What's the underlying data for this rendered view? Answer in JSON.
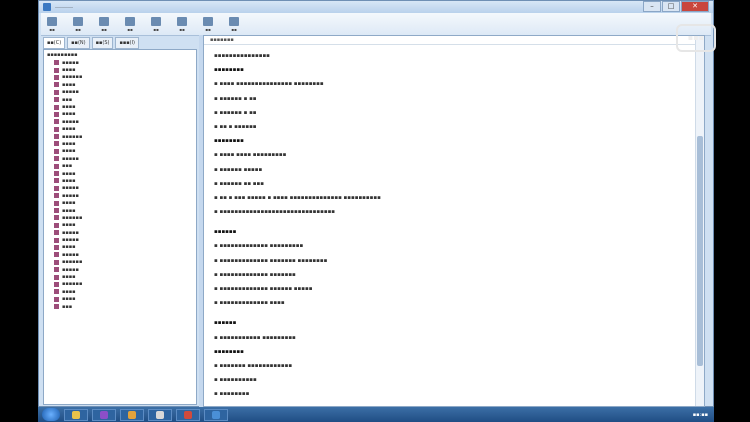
{
  "window": {
    "title": "………",
    "minimize": "–",
    "maximize": "□",
    "close": "✕"
  },
  "toolbar": [
    {
      "name": "hide-tool",
      "icon": "hide-icon",
      "label": "▪▪"
    },
    {
      "name": "locate-tool",
      "icon": "locate-icon",
      "label": "▪▪"
    },
    {
      "name": "back-tool",
      "icon": "back-icon",
      "label": "▪▪"
    },
    {
      "name": "forward-tool",
      "icon": "forward-icon",
      "label": "▪▪"
    },
    {
      "name": "home-tool",
      "icon": "home-icon",
      "label": "▪▪"
    },
    {
      "name": "print-tool",
      "icon": "print-icon",
      "label": "▪▪"
    },
    {
      "name": "options-tool",
      "icon": "options-icon",
      "label": "▪▪"
    },
    {
      "name": "help-tool",
      "icon": "help-icon",
      "label": "▪▪"
    }
  ],
  "tabs": [
    "▪▪(C)",
    "▪▪(N)",
    "▪▪(S)",
    "▪▪▪(I)"
  ],
  "toc": {
    "root": "▪▪▪▪▪▪▪▪▪",
    "items": [
      "▪▪▪▪▪",
      "▪▪▪▪",
      "▪▪▪▪▪▪",
      "▪▪▪▪",
      "▪▪▪▪▪",
      "▪▪▪",
      "▪▪▪▪",
      "▪▪▪▪",
      "▪▪▪▪▪",
      "▪▪▪▪",
      "▪▪▪▪▪▪",
      "▪▪▪▪",
      "▪▪▪▪",
      "▪▪▪▪▪",
      "▪▪▪",
      "▪▪▪▪",
      "▪▪▪▪",
      "▪▪▪▪▪",
      "▪▪▪▪▪",
      "▪▪▪▪",
      "▪▪▪▪",
      "▪▪▪▪▪▪",
      "▪▪▪▪",
      "▪▪▪▪▪",
      "▪▪▪▪▪",
      "▪▪▪▪",
      "▪▪▪▪▪",
      "▪▪▪▪▪▪",
      "▪▪▪▪▪",
      "▪▪▪▪",
      "▪▪▪▪▪▪",
      "▪▪▪▪",
      "▪▪▪▪",
      "▪▪▪"
    ]
  },
  "content": {
    "header": "▪▪▪▪▪▪▪",
    "lines": [
      {
        "t": "▪▪▪▪▪▪▪▪▪▪▪▪▪▪▪",
        "h": false
      },
      {
        "t": "▪▪▪▪▪▪▪▪",
        "h": true
      },
      {
        "t": "▪ ▪▪▪▪ ▪▪▪▪▪▪▪▪▪▪▪▪▪▪▪ ▪▪▪▪▪▪▪▪",
        "h": false
      },
      {
        "t": "▪ ▪▪▪▪▪▪ ▪ ▪▪",
        "h": false
      },
      {
        "t": "▪ ▪▪▪▪▪▪ ▪ ▪▪",
        "h": false
      },
      {
        "t": "▪ ▪▪ ▪ ▪▪▪▪▪▪",
        "h": false
      },
      {
        "t": "▪▪▪▪▪▪▪▪",
        "h": true
      },
      {
        "t": "▪ ▪▪▪▪ ▪▪▪▪ ▪▪▪▪▪▪▪▪▪",
        "h": false
      },
      {
        "t": "▪ ▪▪▪▪▪▪ ▪▪▪▪▪",
        "h": false
      },
      {
        "t": "▪ ▪▪▪▪▪▪ ▪▪ ▪▪▪",
        "h": false
      },
      {
        "t": "▪ ▪▪ ▪ ▪▪▪ ▪▪▪▪▪ ▪ ▪▪▪▪ ▪▪▪▪▪▪▪▪▪▪▪▪▪▪ ▪▪▪▪▪▪▪▪▪▪",
        "h": false
      },
      {
        "t": "▪ ▪▪▪▪▪▪▪▪▪▪▪▪▪▪▪▪▪▪▪▪▪▪▪▪▪▪▪▪▪▪▪",
        "h": false
      },
      {
        "t": "",
        "h": false
      },
      {
        "t": "▪▪▪▪▪▪",
        "h": true
      },
      {
        "t": "▪ ▪▪▪▪▪▪▪▪▪▪▪▪▪ ▪▪▪▪▪▪▪▪▪",
        "h": false
      },
      {
        "t": "▪ ▪▪▪▪▪▪▪▪▪▪▪▪▪ ▪▪▪▪▪▪▪ ▪▪▪▪▪▪▪▪",
        "h": false
      },
      {
        "t": "▪ ▪▪▪▪▪▪▪▪▪▪▪▪▪ ▪▪▪▪▪▪▪",
        "h": false
      },
      {
        "t": "▪ ▪▪▪▪▪▪▪▪▪▪▪▪▪ ▪▪▪▪▪▪ ▪▪▪▪▪",
        "h": false
      },
      {
        "t": "▪ ▪▪▪▪▪▪▪▪▪▪▪▪▪ ▪▪▪▪",
        "h": false
      },
      {
        "t": "",
        "h": false
      },
      {
        "t": "▪▪▪▪▪▪",
        "h": true
      },
      {
        "t": "▪ ▪▪▪▪▪▪▪▪▪▪▪ ▪▪▪▪▪▪▪▪▪",
        "h": false
      },
      {
        "t": "▪▪▪▪▪▪▪▪",
        "h": true
      },
      {
        "t": "▪ ▪▪▪▪▪▪▪ ▪▪▪▪▪▪▪▪▪▪▪▪",
        "h": false
      },
      {
        "t": "▪ ▪▪▪▪▪▪▪▪▪▪",
        "h": false
      },
      {
        "t": "▪ ▪▪▪▪▪▪▪▪",
        "h": false
      }
    ]
  },
  "taskbar": {
    "apps": [
      {
        "name": "taskbar-explorer",
        "color": "#e8c34a"
      },
      {
        "name": "taskbar-media",
        "color": "#8b4fc9"
      },
      {
        "name": "taskbar-folder",
        "color": "#e2a23c"
      },
      {
        "name": "taskbar-app",
        "color": "#d9d9d9"
      },
      {
        "name": "taskbar-browser",
        "color": "#d04a3c"
      },
      {
        "name": "taskbar-help",
        "color": "#4a8fd6"
      }
    ],
    "clock": "▪▪:▪▪"
  },
  "logo": "▪▪▪"
}
